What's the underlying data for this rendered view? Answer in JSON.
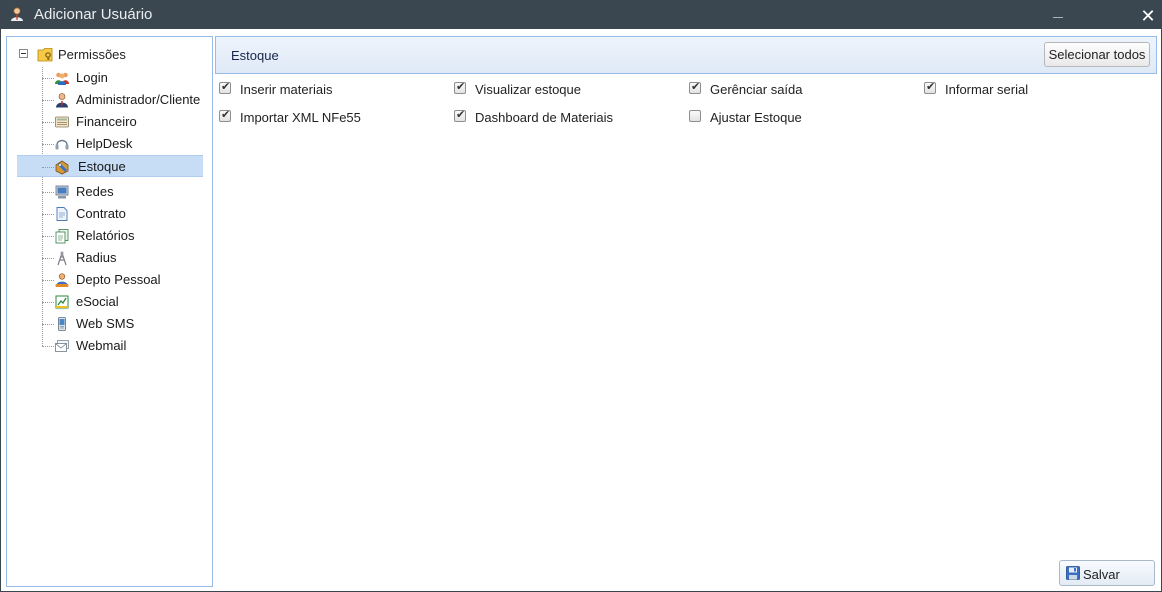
{
  "window": {
    "title": "Adicionar Usuário",
    "minimize_label": "_",
    "close_label": "✕"
  },
  "tree": {
    "root": {
      "label": "Permissões",
      "icon": "folder-key-icon"
    },
    "items": [
      {
        "label": "Login",
        "icon": "users-group-icon"
      },
      {
        "label": "Administrador/Cliente",
        "icon": "admin-user-icon"
      },
      {
        "label": "Financeiro",
        "icon": "calculator-icon"
      },
      {
        "label": "HelpDesk",
        "icon": "headset-icon"
      },
      {
        "label": "Estoque",
        "icon": "tag-box-icon",
        "selected": true
      },
      {
        "label": "Redes",
        "icon": "computer-icon"
      },
      {
        "label": "Contrato",
        "icon": "document-icon"
      },
      {
        "label": "Relatórios",
        "icon": "reports-icon"
      },
      {
        "label": "Radius",
        "icon": "antenna-icon"
      },
      {
        "label": "Depto Pessoal",
        "icon": "person-badge-icon"
      },
      {
        "label": "eSocial",
        "icon": "esocial-icon"
      },
      {
        "label": "Web SMS",
        "icon": "phone-icon"
      },
      {
        "label": "Webmail",
        "icon": "mail-icon"
      }
    ]
  },
  "panel": {
    "title": "Estoque",
    "select_all_label": "Selecionar todos",
    "permissions": [
      [
        {
          "label": "Inserir materiais",
          "checked": true
        },
        {
          "label": "Visualizar estoque",
          "checked": true
        },
        {
          "label": "Gerênciar saída",
          "checked": true
        },
        {
          "label": "Informar serial",
          "checked": true
        }
      ],
      [
        {
          "label": "Importar XML NFe55",
          "checked": true
        },
        {
          "label": "Dashboard de Materiais",
          "checked": true
        },
        {
          "label": "Ajustar Estoque",
          "checked": false
        }
      ]
    ]
  },
  "footer": {
    "save_label": "Salvar",
    "save_icon": "floppy-disk-icon"
  },
  "colors": {
    "titlebar": "#3b4750",
    "selection": "#c7dcf5",
    "panel_border": "#99bbe8"
  }
}
